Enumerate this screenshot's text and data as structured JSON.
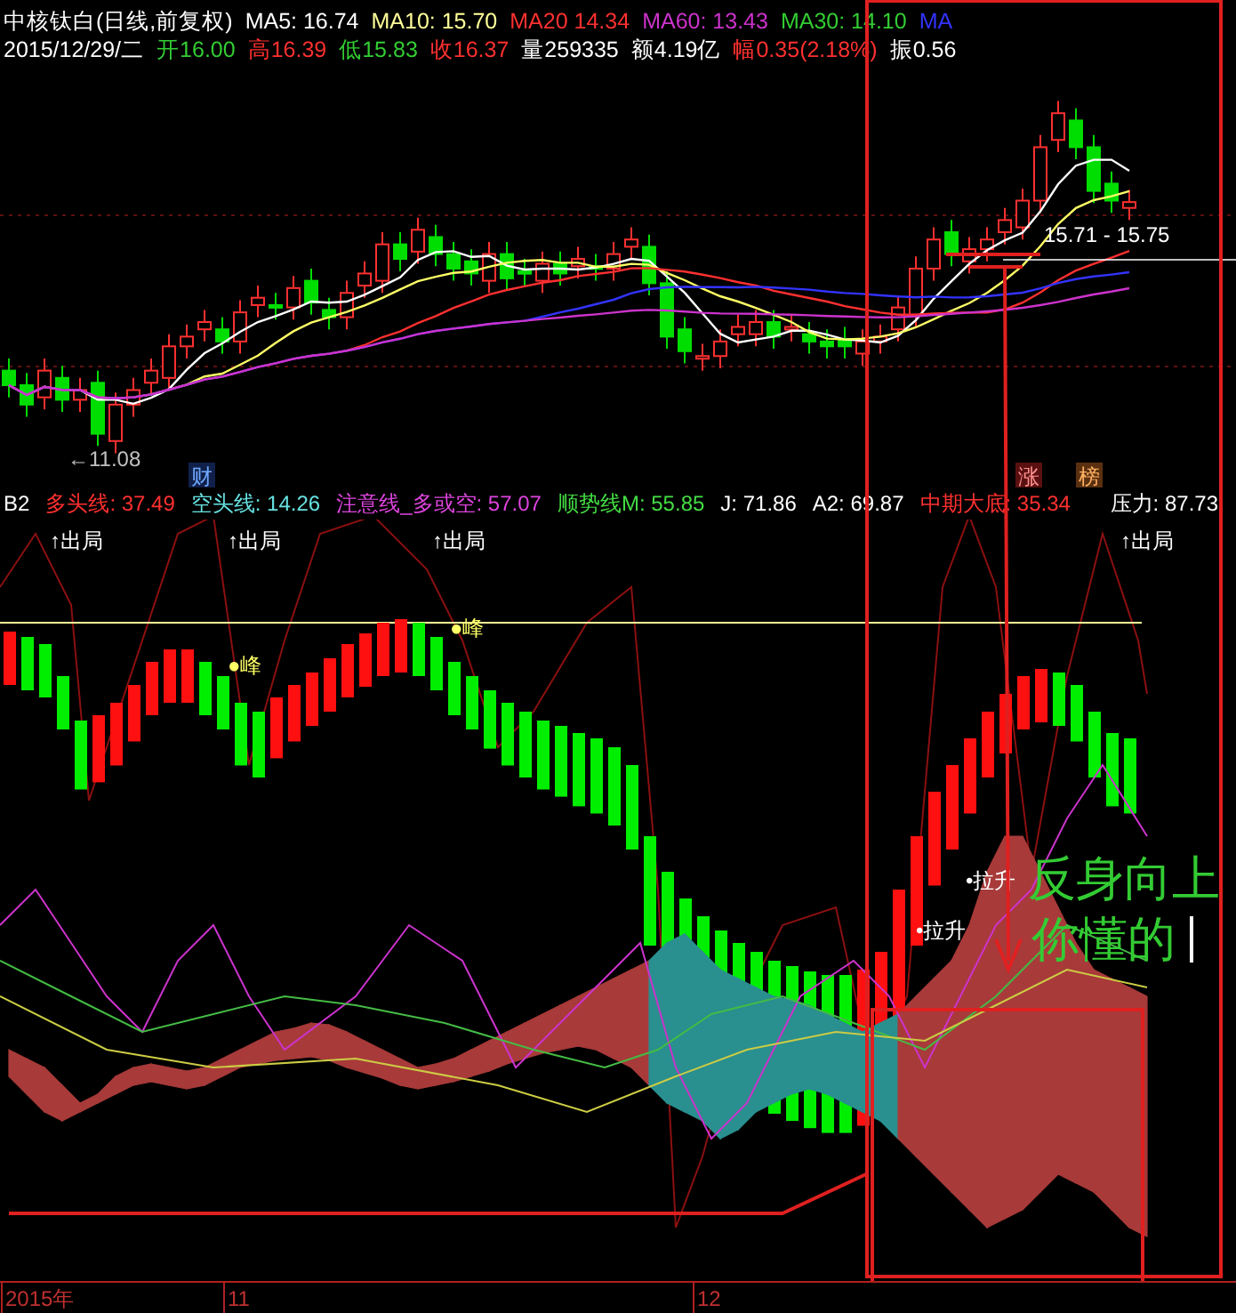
{
  "header": {
    "title": "中核钛白(日线,前复权)",
    "ma": [
      {
        "text": "MA5: 16.74",
        "color": "#ffffff"
      },
      {
        "text": "MA10: 15.70",
        "color": "#ffff99"
      },
      {
        "text": "MA20  14.34",
        "color": "#ff3030"
      },
      {
        "text": "MA60: 13.43",
        "color": "#cc33cc"
      },
      {
        "text": "MA30: 14.10",
        "color": "#33cc33"
      },
      {
        "text": "MA",
        "color": "#3333ff"
      }
    ],
    "quote": [
      {
        "text": "2015/12/29/二",
        "color": "#ffffff"
      },
      {
        "text": "开16.00",
        "color": "#33cc33"
      },
      {
        "text": "高16.39",
        "color": "#ff3030"
      },
      {
        "text": "低15.83",
        "color": "#33cc33"
      },
      {
        "text": "收16.37",
        "color": "#ff3030"
      },
      {
        "text": "量259335",
        "color": "#ffffff"
      },
      {
        "text": "额4.19亿",
        "color": "#ffffff"
      },
      {
        "text": "幅0.35(2.18%)",
        "color": "#ff3030"
      },
      {
        "text": "振0.56",
        "color": "#ffffff"
      }
    ]
  },
  "main_chart": {
    "labels": [
      {
        "text": "←11.08",
        "color": "#c0c0c0"
      },
      {
        "text": "15.71 - 15.75",
        "color": "#ffffff"
      }
    ],
    "tags": [
      {
        "text": "财",
        "color": "#6fa8ff"
      },
      {
        "text": "涨",
        "color": "#ff9090"
      },
      {
        "text": "榜",
        "color": "#ffb060"
      }
    ]
  },
  "indicator": {
    "name": "B2",
    "values": [
      {
        "text": "多头线: 37.49",
        "color": "#ff3030"
      },
      {
        "text": "空头线: 14.26",
        "color": "#66e0e0"
      },
      {
        "text": "注意线_多或空: 57.07",
        "color": "#dd44dd"
      },
      {
        "text": "顺势线M: 55.85",
        "color": "#44dd44"
      },
      {
        "text": "J: 71.86",
        "color": "#ffffff"
      },
      {
        "text": "A2: 69.87",
        "color": "#ffffff"
      },
      {
        "text": "中期大底: 35.34",
        "color": "#ff3030"
      },
      {
        "text": "压力: 87.73",
        "color": "#ffffff"
      }
    ]
  },
  "signals": {
    "exit": [
      "↑出局",
      "↑出局",
      "↑出局",
      "↑出局"
    ],
    "peak": [
      "●峰",
      "●峰"
    ],
    "lift": [
      "•拉升",
      "•拉升"
    ]
  },
  "comment": [
    "反身向上",
    "你懂的"
  ],
  "axis": [
    "2015年",
    "11",
    "12"
  ]
}
